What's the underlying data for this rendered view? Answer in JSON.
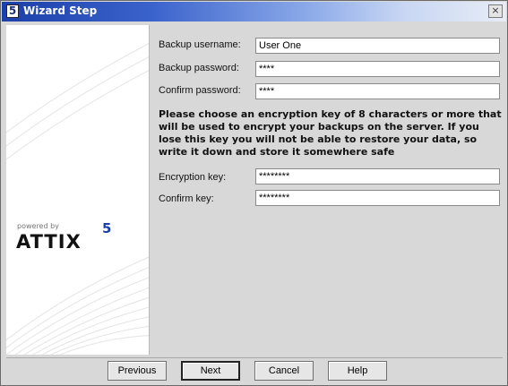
{
  "window": {
    "title": "Wizard Step",
    "app_icon": "5",
    "close_icon": "×"
  },
  "branding": {
    "powered_by": "powered by",
    "logo_text": "ATTIX",
    "logo_superscript": "5"
  },
  "form": {
    "backup_username": {
      "label": "Backup username:",
      "value": "User One"
    },
    "backup_password": {
      "label": "Backup password:",
      "value": "****"
    },
    "confirm_password": {
      "label": "Confirm password:",
      "value": "****"
    },
    "note": "Please choose an encryption key of 8 characters or more that will be used to encrypt your backups on the server. If you lose this key you will not be able to restore your data, so write it down and store it somewhere safe",
    "encryption_key": {
      "label": "Encryption key:",
      "value": "********"
    },
    "confirm_key": {
      "label": "Confirm key:",
      "value": "********"
    }
  },
  "buttons": {
    "previous": "Previous",
    "next": "Next",
    "cancel": "Cancel",
    "help": "Help"
  }
}
